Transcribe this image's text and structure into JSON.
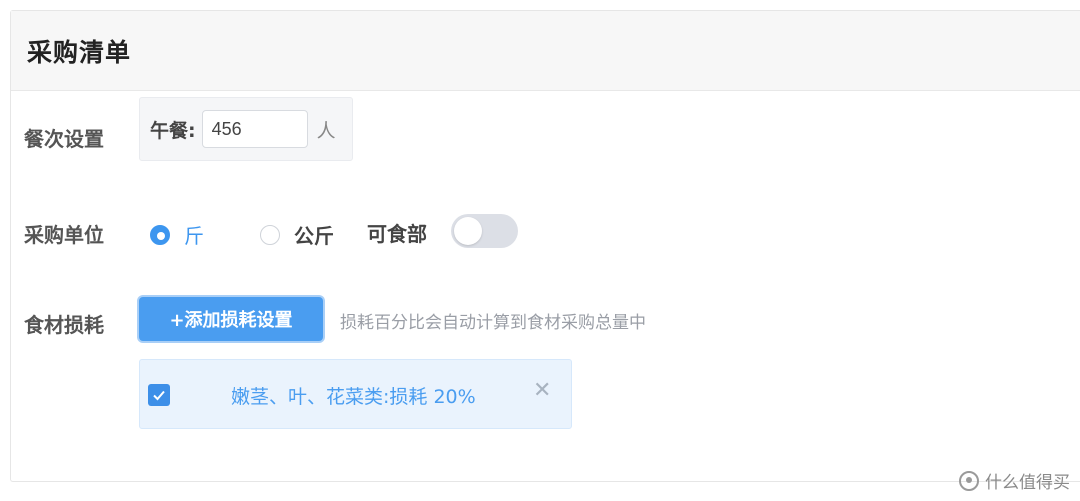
{
  "card": {
    "title": "采购清单"
  },
  "meal_settings": {
    "label": "餐次设置",
    "meal_name": "午餐:",
    "count_value": "456",
    "unit": "人"
  },
  "purchase_unit": {
    "label": "采购单位",
    "options": [
      {
        "label": "斤",
        "checked": true
      },
      {
        "label": "公斤",
        "checked": false
      }
    ],
    "edible_label": "可食部",
    "edible_toggle_on": false
  },
  "food_loss": {
    "label": "食材损耗",
    "add_button_label": "+添加损耗设置",
    "hint": "损耗百分比会自动计算到食材采购总量中",
    "items": [
      {
        "text": "嫩茎、叶、花菜类:损耗 20%",
        "checked": true,
        "close_icon": "close-icon"
      }
    ]
  },
  "watermark": {
    "text": "什么值得买"
  },
  "colors": {
    "primary": "#3d96ef",
    "tag_bg": "#eaf3fd",
    "header_bg": "#f7f7f7"
  }
}
